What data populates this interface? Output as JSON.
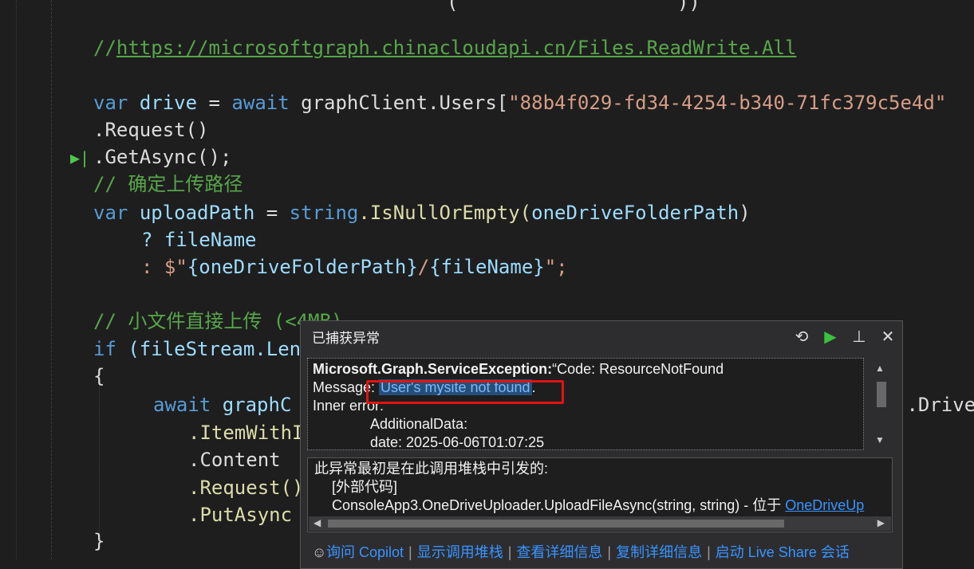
{
  "code": {
    "comment_url": "https://microsoftgraph.chinacloudapi.cn/Files.ReadWrite.All",
    "line_drive": {
      "var": "var",
      "name": "drive",
      "eq": " = ",
      "await": "await",
      "client": "graphClient.",
      "users": "Users[",
      "id": "\"88b4f029-fd34-4254-b340-71fc379c5e4d\""
    },
    "request": ".Request()",
    "getasync": ".GetAsync();",
    "comment_upload_path": "// 确定上传路径",
    "upload_var": "var",
    "upload_name": "uploadPath",
    "upload_eq": " = ",
    "string_kw": "string",
    "isnull": ".IsNullOrEmpty(",
    "folder_arg": "oneDriveFolderPath",
    "close_paren": ")",
    "ternary_q": "? fileName",
    "ternary_colon": ": $\"",
    "interp1": "{oneDriveFolderPath}",
    "slash": "/",
    "interp2": "{fileName}",
    "end_str": "\";",
    "comment_small": "// 小文件直接上传 (<4MB)",
    "if_kw": "if",
    "if_rest": " (fileStream.Len",
    "brace_open": "{",
    "await2": "await",
    "graph_c": " graphC",
    "drive_suffix": "].Drive",
    "item_with": ".ItemWithI",
    "content": ".Content",
    "request2": ".Request()",
    "putasync": ".PutAsync",
    "brace_close": "}",
    "top_fragment": "(                   ))"
  },
  "popup": {
    "title": "已捕获异常",
    "exception_type": "Microsoft.Graph.ServiceException:",
    "code_text": "“Code: ResourceNotFound",
    "message_label": "Message: ",
    "message_value": "User's mysite not found",
    "message_period": ".",
    "inner_error": "Inner error:",
    "additional_data": "AdditionalData:",
    "date": "date: 2025-06-06T01:07:25",
    "stack_heading": "此异常最初是在此调用堆栈中引发的:",
    "external_code": "[外部代码]",
    "stack_frame": "ConsoleApp3.OneDriveUploader.UploadFileAsync(string, string) - 位于 ",
    "stack_frame_link": "OneDriveUp",
    "footer": {
      "copilot": "询问 Copilot",
      "show_stack": "显示调用堆栈",
      "view_details": "查看详细信息",
      "copy_details": "复制详细信息",
      "live_share": "启动 Live Share 会话"
    }
  }
}
